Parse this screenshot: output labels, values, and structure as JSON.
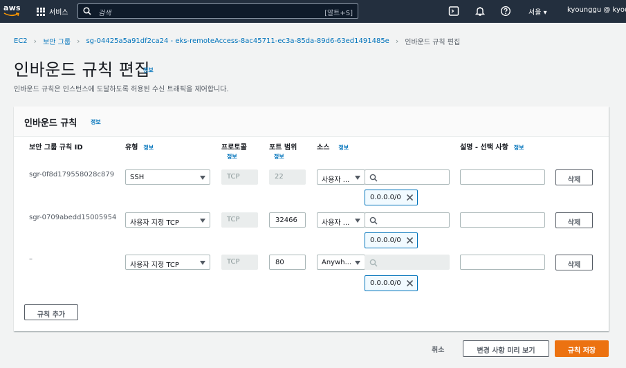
{
  "topnav": {
    "logo_text": "aws",
    "services_label": "서비스",
    "search_placeholder": "검색",
    "search_shortcut": "[알트+S]",
    "region": "서울 ▾",
    "user": "kyounggu @ kyoung",
    "icons": [
      "cloudshell-icon",
      "bell-icon",
      "help-icon"
    ]
  },
  "breadcrumb": {
    "items": [
      "EC2",
      "보안 그룹",
      "sg-04425a5a91df2ca24 - eks-remoteAccess-8ac45711-ec3a-85da-89d6-63ed1491485e"
    ],
    "current": "인바운드 규칙 편집"
  },
  "page": {
    "title": "인바운드 규칙 편집",
    "info": "정보",
    "description": "인바운드 규칙은 인스턴스에 도달하도록 허용된 수신 트래픽을 제어합니다."
  },
  "panel": {
    "title": "인바운드 규칙",
    "info": "정보",
    "columns": {
      "rule_id": "보안 그룹 규칙 ID",
      "type": "유형",
      "protocol": "프로토콜",
      "port_range": "포트 범위",
      "source": "소스",
      "description": "설명 - 선택 사항",
      "info": "정보"
    },
    "rules": [
      {
        "id": "sgr-0f8d179558028c879",
        "type": "SSH",
        "protocol": "TCP",
        "port": "22",
        "source_type": "사용자 ...",
        "token": "0.0.0.0/0",
        "delete": "삭제"
      },
      {
        "id": "sgr-0709abedd15005954",
        "type": "사용자 지정 TCP",
        "protocol": "TCP",
        "port": "32466",
        "source_type": "사용자 ...",
        "token": "0.0.0.0/0",
        "delete": "삭제"
      },
      {
        "id": "–",
        "type": "사용자 지정 TCP",
        "protocol": "TCP",
        "port": "80",
        "source_type": "Anywh...",
        "token": "0.0.0.0/0",
        "delete": "삭제"
      }
    ],
    "add_rule": "규칙 추가"
  },
  "footer": {
    "cancel": "취소",
    "preview": "변경 사항 미리 보기",
    "save": "규칙 저장"
  },
  "colors": {
    "nav_bg": "#232f3e",
    "link": "#0073bb",
    "primary": "#ec7211"
  }
}
